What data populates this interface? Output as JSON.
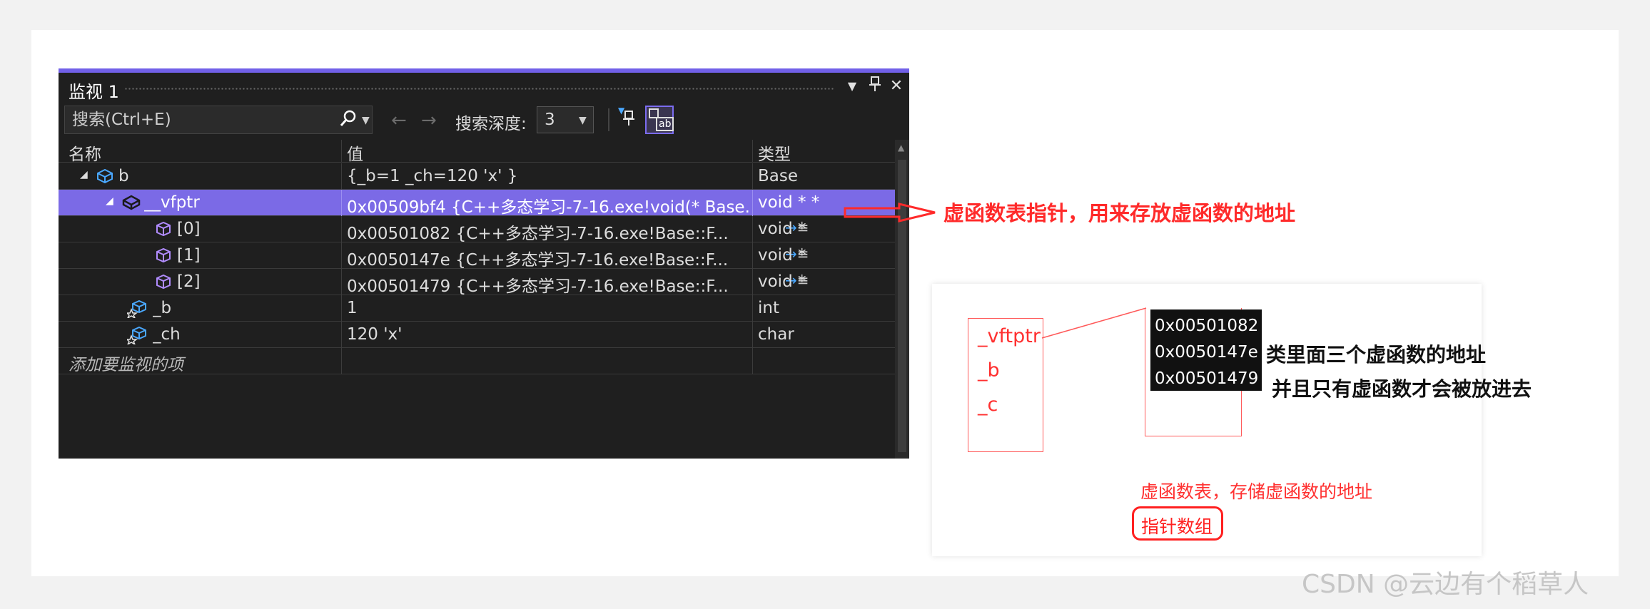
{
  "window": {
    "title": "监视 1",
    "dropdown_icon": "dropdown-triangle-icon",
    "pin_icon": "pin-icon",
    "close_icon": "close-icon"
  },
  "toolbar": {
    "search_placeholder": "搜索(Ctrl+E)",
    "depth_label": "搜索深度:",
    "depth_value": "3"
  },
  "columns": {
    "name": "名称",
    "value": "值",
    "type": "类型"
  },
  "rows": [
    {
      "name": "b",
      "value": "{_b=1 _ch=120 'x' }",
      "type": "Base"
    },
    {
      "name": "__vfptr",
      "value": "0x00509bf4 {C++多态学习-7-16.exe!void(* Base...",
      "type": "void * *"
    },
    {
      "name": "[0]",
      "value": "0x00501082 {C++多态学习-7-16.exe!Base::F...",
      "type": "void *"
    },
    {
      "name": "[1]",
      "value": "0x0050147e {C++多态学习-7-16.exe!Base::F...",
      "type": "void *"
    },
    {
      "name": "[2]",
      "value": "0x00501479 {C++多态学习-7-16.exe!Base::F...",
      "type": "void *"
    },
    {
      "name": "_b",
      "value": "1",
      "type": "int"
    },
    {
      "name": "_ch",
      "value": "120 'x'",
      "type": "char"
    }
  ],
  "add_item_text": "添加要监视的项",
  "annotations": {
    "vfptr_note": "虚函数表指针，用来存放虚函数的地址",
    "object_fields": [
      "_vftptr",
      "_b",
      "_c"
    ],
    "vtable_entries": [
      "0x00501082",
      "0x0050147e",
      "0x00501479"
    ],
    "vtable_note_1": "类里面三个虚函数的地址",
    "vtable_note_2": "并且只有虚函数才会被放进去",
    "vtable_caption": "虚函数表，存储虚函数的地址",
    "pointer_array": "指针数组"
  },
  "watermark": "CSDN @云边有个稻草人",
  "colors": {
    "accent": "#7160e8",
    "selected_row": "#7b6ae6",
    "annotation_red": "#ff2a2a"
  }
}
